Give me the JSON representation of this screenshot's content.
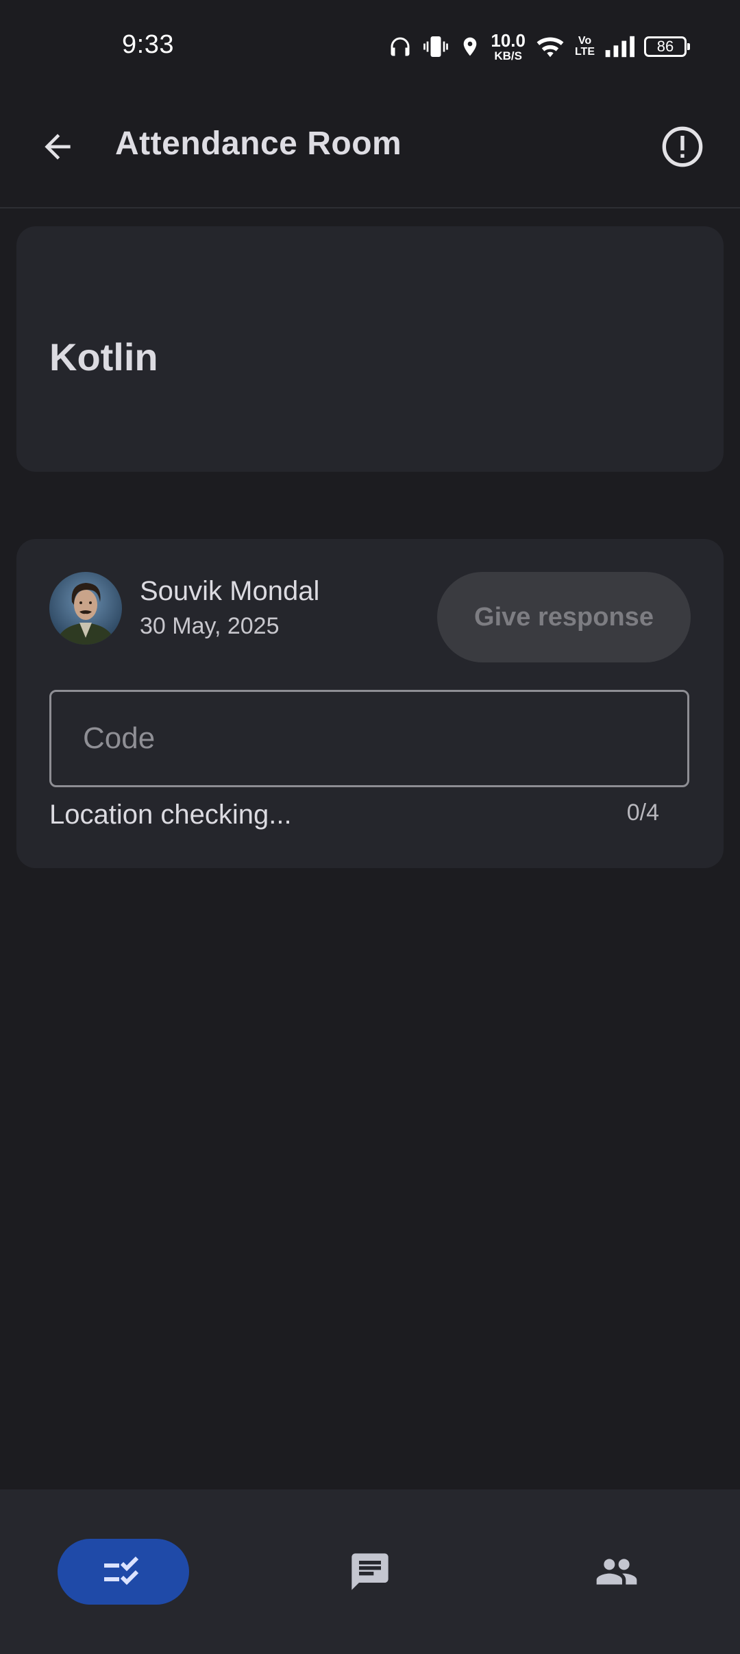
{
  "status_bar": {
    "time": "9:33",
    "net_speed_value": "10.0",
    "net_speed_unit": "KB/S",
    "volte_top": "Vo",
    "volte_bottom": "LTE",
    "battery": "86",
    "icons": [
      "headphones-icon",
      "vibrate-icon",
      "location-icon",
      "wifi-icon",
      "volte-icon",
      "signal-icon",
      "battery-icon"
    ]
  },
  "app_bar": {
    "title": "Attendance Room",
    "back_icon": "arrow-back-icon",
    "info_icon": "info-alert-icon"
  },
  "class_card": {
    "name": "Kotlin"
  },
  "attendance": {
    "user_name": "Souvik Mondal",
    "date": "30 May, 2025",
    "give_response_label": "Give response",
    "code_placeholder": "Code",
    "code_value": "",
    "location_status": "Location checking...",
    "char_count": "0/4"
  },
  "bottom_nav": {
    "items": [
      {
        "name": "assignments",
        "icon": "checklist-icon",
        "selected": true
      },
      {
        "name": "chat",
        "icon": "chat-icon",
        "selected": false
      },
      {
        "name": "people",
        "icon": "people-icon",
        "selected": false
      }
    ]
  },
  "colors": {
    "background": "#1c1c20",
    "card": "#25262c",
    "nav_selected": "#1f4aa8",
    "button_disabled": "#3a3b40"
  }
}
